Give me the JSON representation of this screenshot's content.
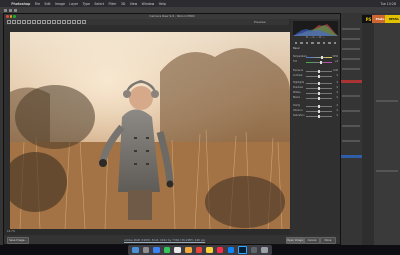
{
  "menubar": {
    "apple": "",
    "items": [
      "Photoshop",
      "File",
      "Edit",
      "Image",
      "Layer",
      "Type",
      "Select",
      "Filter",
      "3D",
      "View",
      "Window",
      "Help"
    ],
    "right_status": "Tue 10:28"
  },
  "camera_raw": {
    "title": "Camera Raw 9.6  -  Nikon D800",
    "preview_label": "Preview",
    "status_zoom": "16.7%",
    "footer_link": "Adobe RGB (1998); 8 bit; 4912 by 7360 (36.2MP); 240 ppi",
    "buttons": {
      "save": "Save Image...",
      "open": "Open Image",
      "cancel": "Cancel",
      "done": "Done"
    },
    "histogram_readout": "R: ---  G: ---  B: ---",
    "panel_title": "Basic",
    "sliders": [
      {
        "label": "Temperature",
        "value": "5250"
      },
      {
        "label": "Tint",
        "value": "+8"
      },
      {
        "label": "Exposure",
        "value": "0.00"
      },
      {
        "label": "Contrast",
        "value": "0"
      },
      {
        "label": "Highlights",
        "value": "0"
      },
      {
        "label": "Shadows",
        "value": "0"
      },
      {
        "label": "Whites",
        "value": "0"
      },
      {
        "label": "Blacks",
        "value": "0"
      },
      {
        "label": "Clarity",
        "value": "0"
      },
      {
        "label": "Vibrance",
        "value": "0"
      },
      {
        "label": "Saturation",
        "value": "0"
      }
    ]
  },
  "side_panel": {
    "badge_ps": "PS",
    "badge_mid": "Pluto",
    "badge_right": "RETAIL"
  },
  "colors": {
    "accent_red": "#b23a3a",
    "accent_blue": "#2f5ea8",
    "badge_yellow": "#e0c200"
  }
}
